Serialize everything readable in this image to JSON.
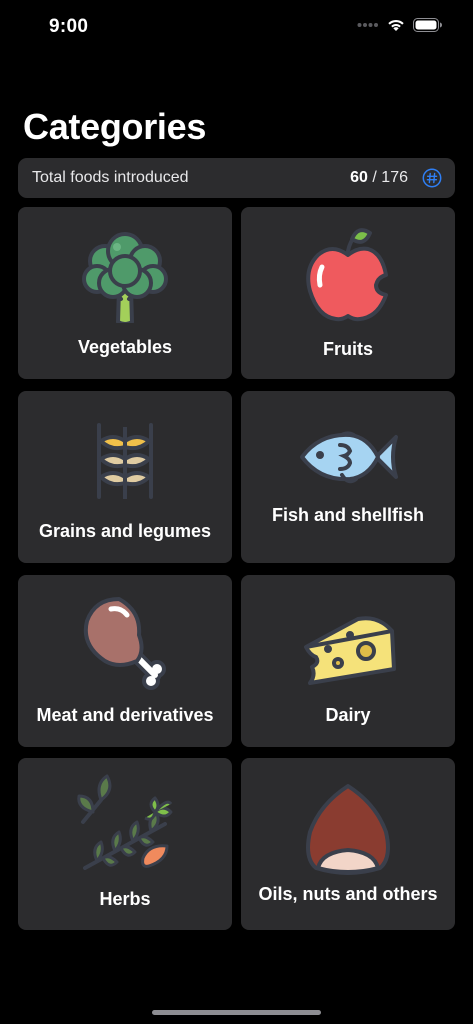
{
  "status_bar": {
    "time": "9:00"
  },
  "header": {
    "title": "Categories"
  },
  "summary": {
    "label": "Total foods introduced",
    "introduced": "60",
    "separator": " / ",
    "total": "176",
    "accent": "#2f7ff5"
  },
  "categories": [
    {
      "label": "Vegetables",
      "icon": "broccoli-icon"
    },
    {
      "label": "Fruits",
      "icon": "apple-icon"
    },
    {
      "label": "Grains and legumes",
      "icon": "wheat-icon"
    },
    {
      "label": "Fish and shellfish",
      "icon": "fish-icon"
    },
    {
      "label": "Meat and derivatives",
      "icon": "drumstick-icon"
    },
    {
      "label": "Dairy",
      "icon": "cheese-icon"
    },
    {
      "label": "Herbs",
      "icon": "herbs-icon"
    },
    {
      "label": "Oils, nuts and others",
      "icon": "chestnut-icon"
    }
  ],
  "colors": {
    "background": "#000000",
    "tile": "#2c2c2e",
    "outline": "#3a3f4b"
  }
}
